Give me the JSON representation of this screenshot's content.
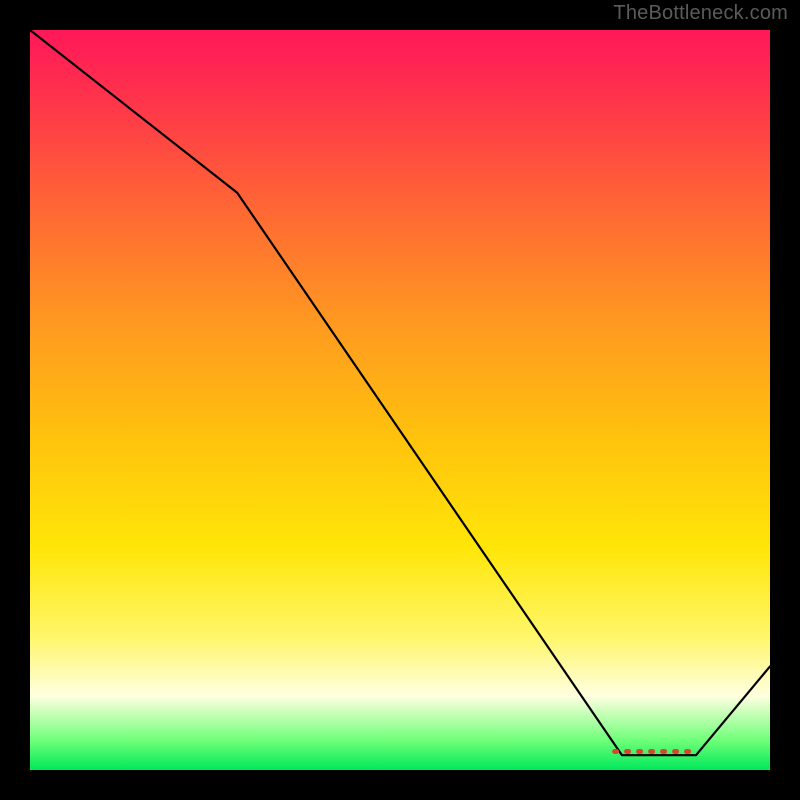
{
  "attribution": "TheBottleneck.com",
  "chart_data": {
    "type": "line",
    "title": "",
    "xlabel": "",
    "ylabel": "",
    "xlim": [
      0,
      100
    ],
    "ylim": [
      0,
      100
    ],
    "grid": false,
    "series": [
      {
        "name": "curve",
        "x": [
          0,
          28,
          80,
          90,
          100
        ],
        "y": [
          100,
          78,
          2,
          2,
          14
        ]
      },
      {
        "name": "flat-markers",
        "x": [
          79,
          90
        ],
        "y": [
          2.5,
          2.5
        ]
      }
    ],
    "gradient_stops": [
      {
        "pos": 0,
        "color": "#ff1859"
      },
      {
        "pos": 8,
        "color": "#ff2f4d"
      },
      {
        "pos": 25,
        "color": "#ff6a33"
      },
      {
        "pos": 40,
        "color": "#ff9a20"
      },
      {
        "pos": 55,
        "color": "#ffc20d"
      },
      {
        "pos": 70,
        "color": "#ffe608"
      },
      {
        "pos": 82,
        "color": "#fff66a"
      },
      {
        "pos": 90,
        "color": "#ffffe0"
      },
      {
        "pos": 96,
        "color": "#6fff79"
      },
      {
        "pos": 100,
        "color": "#00e85a"
      }
    ]
  }
}
